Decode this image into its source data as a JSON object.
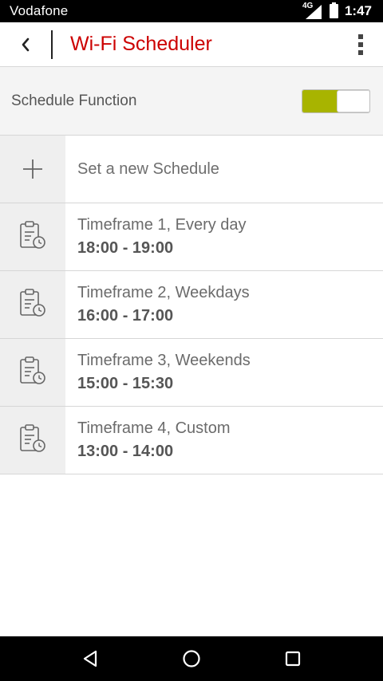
{
  "status_bar": {
    "carrier": "Vodafone",
    "network_type": "4G",
    "time": "1:47",
    "icons": [
      "signal-icon",
      "battery-icon"
    ]
  },
  "app_bar": {
    "title": "Wi-Fi Scheduler",
    "back_icon": "chevron-left-icon",
    "menu_icon": "more-vert-icon"
  },
  "schedule_function": {
    "label": "Schedule Function",
    "enabled": true,
    "accent_color": "#a8b400"
  },
  "add_schedule": {
    "label": "Set a new Schedule",
    "icon": "plus-icon"
  },
  "timeframes": [
    {
      "title": "Timeframe 1, Every day",
      "range": "18:00 - 19:00",
      "icon": "schedule-clipboard-icon"
    },
    {
      "title": "Timeframe 2, Weekdays",
      "range": "16:00 - 17:00",
      "icon": "schedule-clipboard-icon"
    },
    {
      "title": "Timeframe 3, Weekends",
      "range": "15:00 - 15:30",
      "icon": "schedule-clipboard-icon"
    },
    {
      "title": "Timeframe 4, Custom",
      "range": "13:00 - 14:00",
      "icon": "schedule-clipboard-icon"
    }
  ],
  "nav_bar": {
    "icons": [
      "back-triangle-icon",
      "home-circle-icon",
      "recents-square-icon"
    ]
  },
  "colors": {
    "brand_red": "#cc0000",
    "toggle_green": "#a8b400"
  }
}
